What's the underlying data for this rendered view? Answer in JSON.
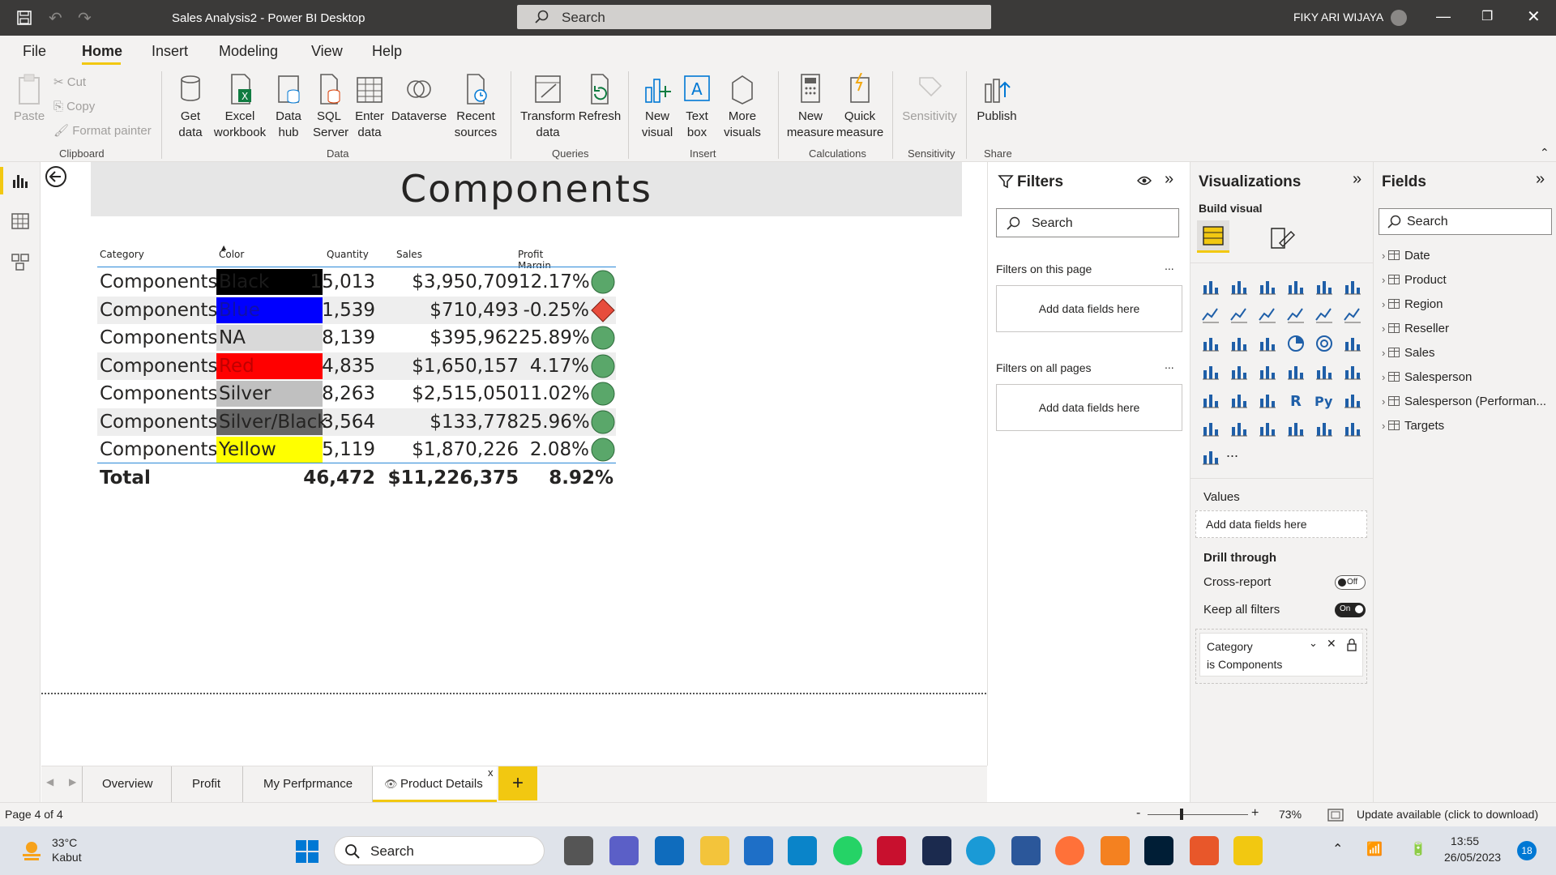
{
  "titlebar": {
    "title": "Sales Analysis2 - Power BI Desktop",
    "search_placeholder": "Search",
    "user": "FIKY ARI WIJAYA"
  },
  "ribbon_tabs": [
    "File",
    "Home",
    "Insert",
    "Modeling",
    "View",
    "Help"
  ],
  "ribbon": {
    "clipboard": {
      "paste": "Paste",
      "cut": "Cut",
      "copy": "Copy",
      "format_painter": "Format painter",
      "group": "Clipboard"
    },
    "data": {
      "get_data": "Get data",
      "excel": "Excel workbook",
      "data_hub": "Data hub",
      "sql": "SQL Server",
      "enter_data": "Enter data",
      "dataverse": "Dataverse",
      "recent": "Recent sources",
      "group": "Data"
    },
    "queries": {
      "transform": "Transform data",
      "refresh": "Refresh",
      "group": "Queries"
    },
    "insert": {
      "new_visual": "New visual",
      "text_box": "Text box",
      "more_visuals": "More visuals",
      "group": "Insert"
    },
    "calculations": {
      "new_measure": "New measure",
      "quick_measure": "Quick measure",
      "group": "Calculations"
    },
    "sensitivity": {
      "label": "Sensitivity",
      "group": "Sensitivity"
    },
    "share": {
      "publish": "Publish",
      "group": "Share"
    }
  },
  "report": {
    "title": "Components",
    "table": {
      "headers": [
        "Category",
        "Color",
        "Quantity",
        "Sales",
        "Profit Margin"
      ],
      "rows": [
        {
          "category": "Components",
          "color": "Black",
          "quantity": "15,013",
          "sales": "$3,950,709",
          "margin": "12.17%",
          "indicator": "green-circle",
          "swatch": "#000000",
          "text_color": "#1a1a1a",
          "row_bg": "#ffffff"
        },
        {
          "category": "Components",
          "color": "Blue",
          "quantity": "1,539",
          "sales": "$710,493",
          "margin": "-0.25%",
          "indicator": "red-diamond",
          "swatch": "#0000ff",
          "text_color": "#1010a8",
          "row_bg": "#eeeeee"
        },
        {
          "category": "Components",
          "color": "NA",
          "quantity": "8,139",
          "sales": "$395,962",
          "margin": "25.89%",
          "indicator": "green-circle",
          "swatch": "#d9d9d9",
          "text_color": "#252423",
          "row_bg": "#ffffff"
        },
        {
          "category": "Components",
          "color": "Red",
          "quantity": "4,835",
          "sales": "$1,650,157",
          "margin": "4.17%",
          "indicator": "green-circle",
          "swatch": "#ff0000",
          "text_color": "#c00000",
          "row_bg": "#eeeeee"
        },
        {
          "category": "Components",
          "color": "Silver",
          "quantity": "8,263",
          "sales": "$2,515,050",
          "margin": "11.02%",
          "indicator": "green-circle",
          "swatch": "#c0c0c0",
          "text_color": "#252423",
          "row_bg": "#ffffff"
        },
        {
          "category": "Components",
          "color": "Silver/Black",
          "quantity": "3,564",
          "sales": "$133,778",
          "margin": "25.96%",
          "indicator": "green-circle",
          "swatch": "#666666",
          "text_color": "#252423",
          "row_bg": "#eeeeee"
        },
        {
          "category": "Components",
          "color": "Yellow",
          "quantity": "5,119",
          "sales": "$1,870,226",
          "margin": "2.08%",
          "indicator": "green-circle",
          "swatch": "#ffff00",
          "text_color": "#252423",
          "row_bg": "#ffffff"
        }
      ],
      "total": {
        "label": "Total",
        "quantity": "46,472",
        "sales": "$11,226,375",
        "margin": "8.92%"
      }
    }
  },
  "filters": {
    "title": "Filters",
    "search": "Search",
    "this_page": "Filters on this page",
    "all_pages": "Filters on all pages",
    "add": "Add data fields here",
    "more": "..."
  },
  "visualizations": {
    "title": "Visualizations",
    "build": "Build visual",
    "values": "Values",
    "add": "Add data fields here",
    "drill": "Drill through",
    "cross_report": "Cross-report",
    "cross_state": "Off",
    "keep_filters": "Keep all filters",
    "keep_state": "On",
    "filter_card": {
      "field": "Category",
      "value": "is Components"
    },
    "more": "..."
  },
  "fields": {
    "title": "Fields",
    "search": "Search",
    "items": [
      "Date",
      "Product",
      "Region",
      "Reseller",
      "Sales",
      "Salesperson",
      "Salesperson (Performan...",
      "Targets"
    ]
  },
  "pages": {
    "tabs": [
      "Overview",
      "Profit",
      "My Perfprmance",
      "Product Details"
    ],
    "active": "Product Details",
    "add": "+",
    "close": "x"
  },
  "status": {
    "page": "Page 4 of 4",
    "zoom": "73%",
    "update": "Update available (click to download)",
    "minus": "-",
    "plus": "+"
  },
  "taskbar": {
    "weather_temp": "33°C",
    "weather_desc": "Kabut",
    "search": "Search",
    "time": "13:55",
    "date": "26/05/2023",
    "notif": "18"
  },
  "colors": {
    "accent": "#f2c811",
    "green": "#5aa76a",
    "red": "#e74c3c",
    "titlebar": "#3b3a39"
  }
}
